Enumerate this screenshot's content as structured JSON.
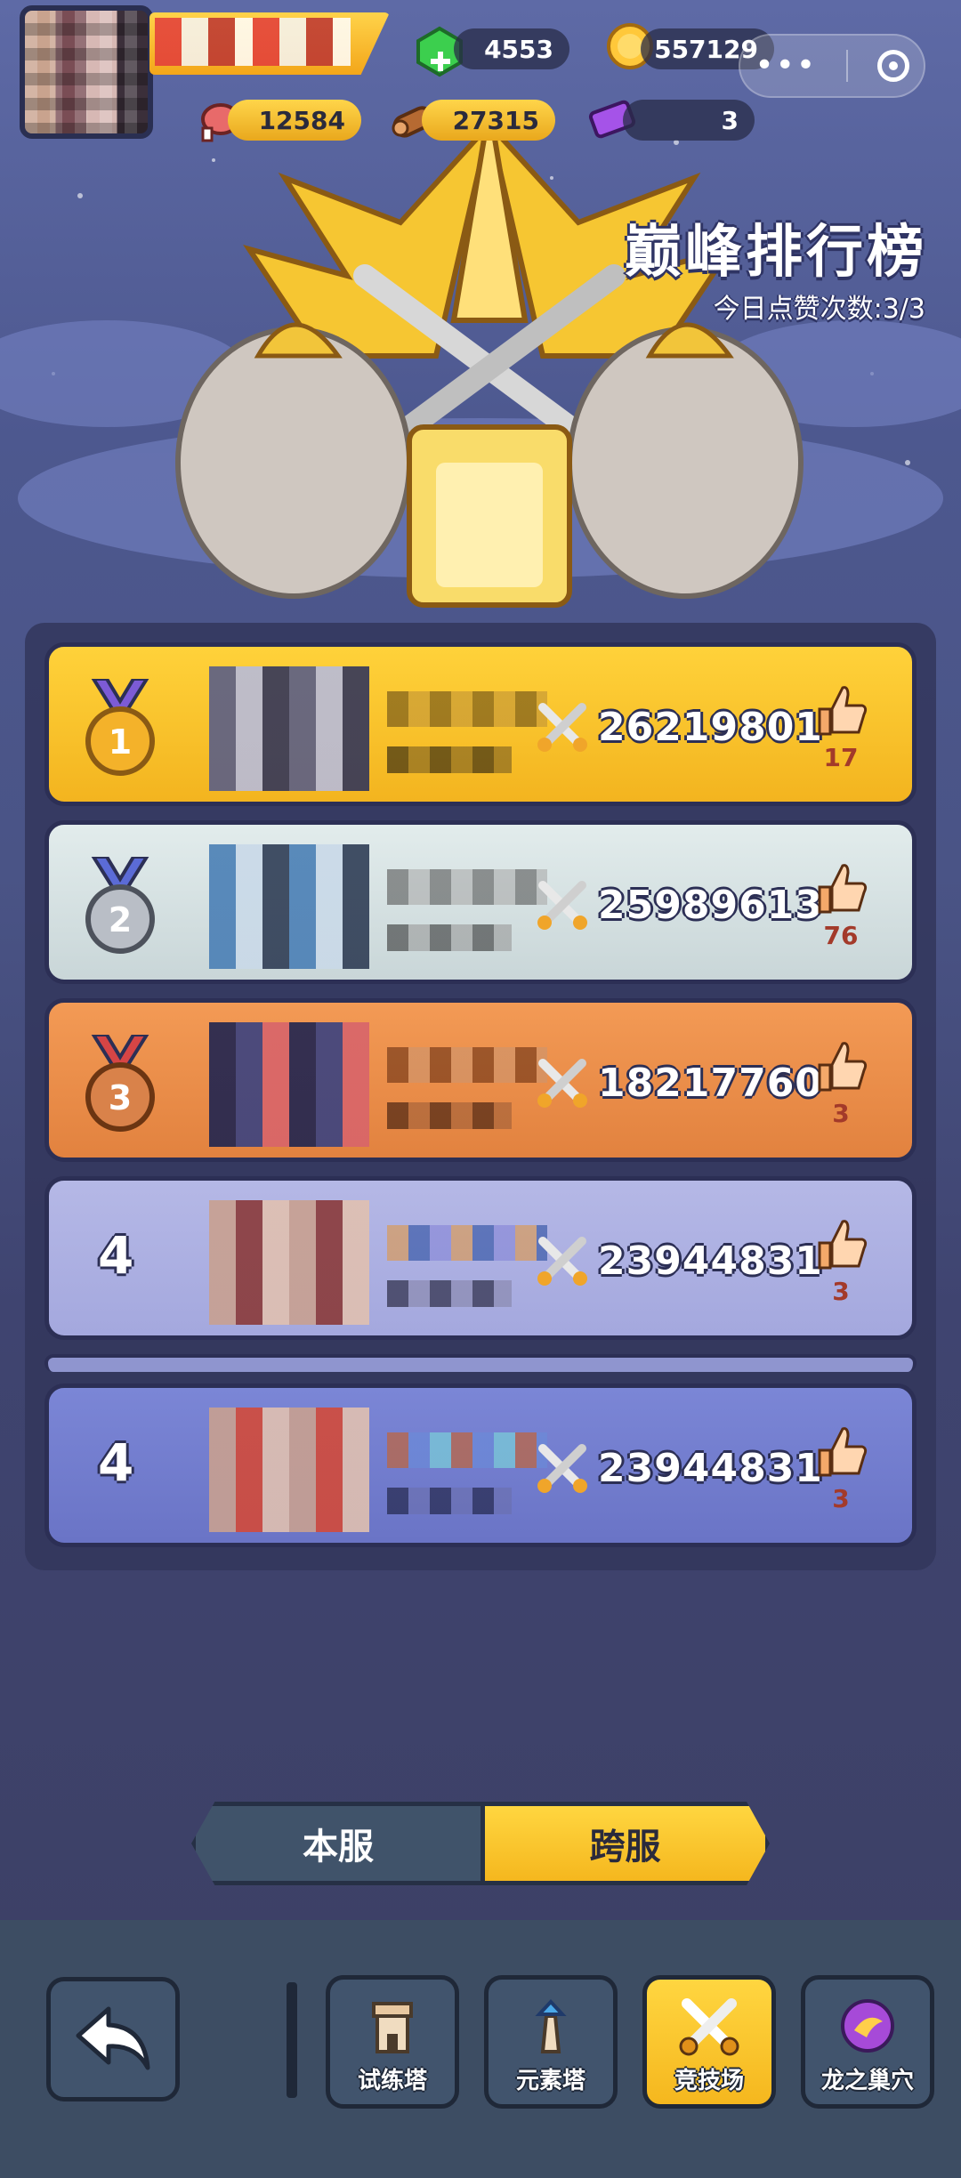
{
  "hud": {
    "resources": [
      {
        "id": "gems",
        "icon": "green-gem-icon",
        "value": "4553"
      },
      {
        "id": "coins",
        "icon": "gold-coin-icon",
        "value": "557129"
      },
      {
        "id": "meat",
        "icon": "meat-icon",
        "value": "12584"
      },
      {
        "id": "wood",
        "icon": "wood-log-icon",
        "value": "27315"
      },
      {
        "id": "tickets",
        "icon": "purple-ticket-icon",
        "value": "3"
      }
    ]
  },
  "header": {
    "title": "巅峰排行榜",
    "likes_today": "今日点赞次数:3/3"
  },
  "leaderboard": [
    {
      "rank": "1",
      "medal": "gold",
      "power": "26219801",
      "likes": "17"
    },
    {
      "rank": "2",
      "medal": "silver",
      "power": "25989613",
      "likes": "76"
    },
    {
      "rank": "3",
      "medal": "bronze",
      "power": "18217760",
      "likes": "3"
    },
    {
      "rank": "4",
      "medal": "",
      "power": "23944831",
      "likes": "3"
    },
    {
      "rank": "4",
      "medal": "",
      "power": "23944831",
      "likes": "3"
    }
  ],
  "server_toggle": {
    "local": "本服",
    "cross": "跨服",
    "selected": "cross"
  },
  "nav": {
    "items": [
      {
        "id": "trial-tower",
        "label": "试练塔",
        "icon": "trial-tower-icon"
      },
      {
        "id": "element-tower",
        "label": "元素塔",
        "icon": "element-tower-icon"
      },
      {
        "id": "arena",
        "label": "竞技场",
        "icon": "crossed-swords-icon",
        "active": true
      },
      {
        "id": "dragon-lair",
        "label": "龙之巢穴",
        "icon": "dragon-orb-icon"
      }
    ]
  },
  "colors": {
    "gold": "#f3b41f",
    "silver": "#c9d6d8",
    "bronze": "#e2823f",
    "lavender": "#a4a8de",
    "blue": "#6a74c6",
    "outline": "#2c2f55"
  }
}
